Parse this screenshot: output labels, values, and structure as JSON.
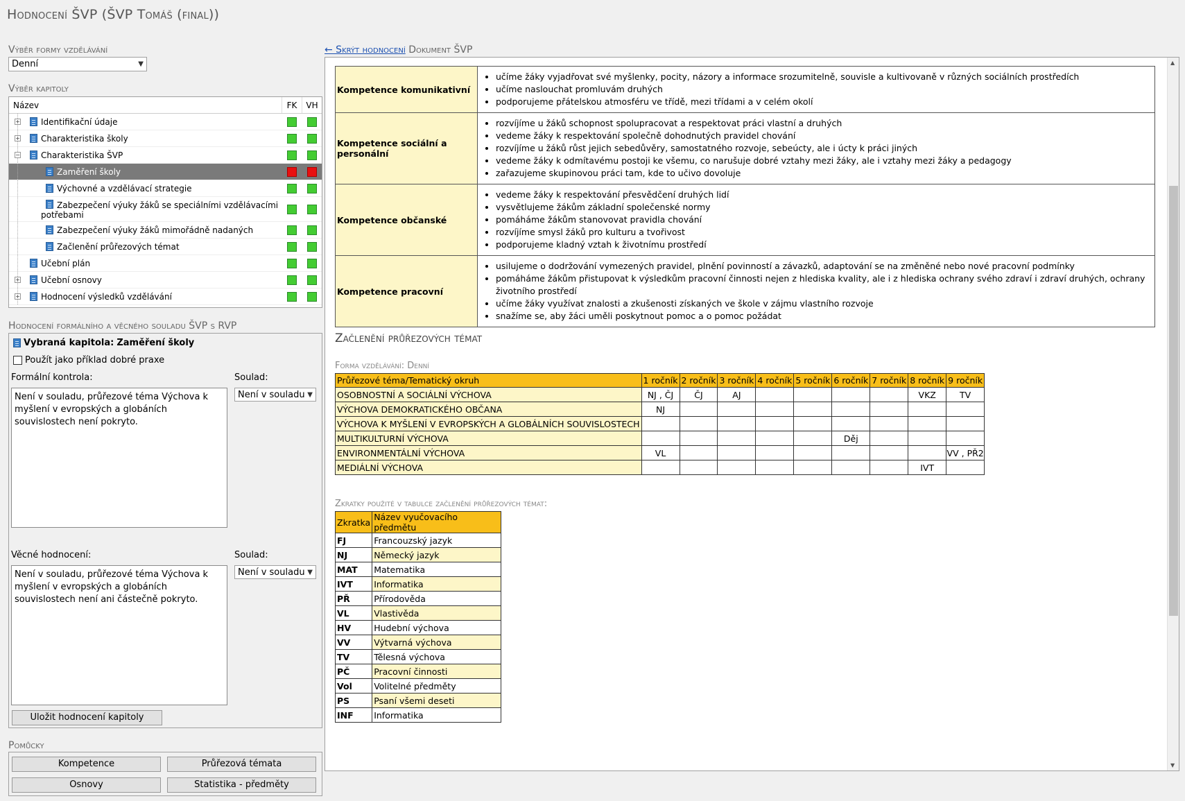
{
  "title": "Hodnocení ŠVP (ŠVP Tomáš (final))",
  "left": {
    "forma_label": "Výběr formy vzdělávání",
    "forma_value": "Denní",
    "kapitola_label": "Výběr kapitoly",
    "tree_headers": {
      "name": "Název",
      "fk": "FK",
      "vh": "VH"
    },
    "tree": [
      {
        "label": "Identifikační údaje",
        "level": 0,
        "expander": "+",
        "fk": "green",
        "vh": "green"
      },
      {
        "label": "Charakteristika školy",
        "level": 0,
        "expander": "+",
        "fk": "green",
        "vh": "green"
      },
      {
        "label": "Charakteristika ŠVP",
        "level": 0,
        "expander": "−",
        "fk": "green",
        "vh": "green"
      },
      {
        "label": "Zaměření školy",
        "level": 1,
        "expander": "",
        "fk": "red",
        "vh": "red",
        "selected": true
      },
      {
        "label": "Výchovné a vzdělávací strategie",
        "level": 1,
        "expander": "",
        "fk": "green",
        "vh": "green"
      },
      {
        "label": "Zabezpečení výuky žáků se speciálními vzdělávacími",
        "label2": "potřebami",
        "level": 1,
        "expander": "",
        "fk": "green",
        "vh": "green"
      },
      {
        "label": "Zabezpečení výuky žáků mimořádně nadaných",
        "level": 1,
        "expander": "",
        "fk": "green",
        "vh": "green"
      },
      {
        "label": "Začlenění průřezových témat",
        "level": 1,
        "expander": "",
        "fk": "green",
        "vh": "green"
      },
      {
        "label": "Učební plán",
        "level": 0,
        "expander": "",
        "fk": "green",
        "vh": "green"
      },
      {
        "label": "Učební osnovy",
        "level": 0,
        "expander": "+",
        "fk": "green",
        "vh": "green"
      },
      {
        "label": "Hodnocení výsledků vzdělávání",
        "level": 0,
        "expander": "+",
        "fk": "green",
        "vh": "green"
      }
    ],
    "hodnoceni_label": "Hodnocení formálního a věcného souladu ŠVP s RVP",
    "vybrana_prefix": "Vybraná kapitola:",
    "vybrana_value": "Zaměření školy",
    "priklad_label": "Použít jako příklad dobré praxe",
    "formalni_label": "Formální kontrola:",
    "soulad_label": "Soulad:",
    "formalni_soulad": "Není v souladu",
    "formalni_text": "Není v souladu, průřezové téma Výchova k myšlení v evropských a globáních souvislostech není pokryto.",
    "vecne_label": "Věcné hodnocení:",
    "vecne_soulad": "Není v souladu",
    "vecne_text": "Není v souladu, průřezové téma Výchova k myšlení v evropských a globáních souvislostech není ani částečně pokryto.",
    "ulozit": "Uložit hodnocení kapitoly",
    "pomucky_label": "Pomůcky",
    "pomucky": [
      "Kompetence",
      "Průřezová témata",
      "Osnovy",
      "Statistika - předměty"
    ]
  },
  "right": {
    "hide_link": "← Skrýt hodnocení",
    "doc_label": "Dokument ŠVP",
    "kompetence": [
      {
        "name": "Kompetence komunikativní",
        "items": [
          "učíme žáky vyjadřovat své myšlenky, pocity, názory a informace srozumitelně, souvisle a kultivovaně v různých sociálních prostředích",
          "učíme naslouchat promluvám druhých",
          "podporujeme přátelskou atmosféru ve třídě, mezi třídami a v celém okolí"
        ]
      },
      {
        "name": "Kompetence sociální a personální",
        "items": [
          "rozvíjíme u žáků schopnost spolupracovat a respektovat práci vlastní a druhých",
          "vedeme žáky k respektování společně dohodnutých pravidel chování",
          "rozvíjíme u žáků růst jejich sebedůvěry, samostatného rozvoje, sebeúcty, ale i úcty k práci jiných",
          "vedeme žáky k odmítavému postoji ke všemu, co narušuje dobré vztahy mezi žáky, ale i vztahy mezi žáky a pedagogy",
          "zařazujeme skupinovou práci tam, kde to učivo dovoluje"
        ]
      },
      {
        "name": "Kompetence občanské",
        "items": [
          "vedeme žáky k respektování přesvědčení druhých lidí",
          "vysvětlujeme žákům základní společenské normy",
          "pomáháme žákům stanovovat pravidla chování",
          "rozvíjíme smysl žáků pro kulturu a tvořivost",
          "podporujeme kladný vztah k životnímu prostředí"
        ]
      },
      {
        "name": "Kompetence pracovní",
        "items": [
          "usilujeme o dodržování vymezených pravidel, plnění povinností a závazků, adaptování se na změněné nebo nové pracovní podmínky",
          "pomáháme žákům přistupovat k výsledkům pracovní činnosti nejen z hlediska kvality, ale i z hlediska ochrany svého zdraví i zdraví druhých, ochrany životního prostředí",
          "učíme žáky využívat znalosti a zkušenosti získaných ve škole v zájmu vlastního rozvoje",
          "snažíme se, aby žáci uměli poskytnout pomoc a o pomoc požádat"
        ]
      }
    ],
    "zac_title": "Začlenění průřezových témat",
    "forma_label": "Forma vzdělávání: Denní",
    "zt_headers": [
      "Průřezové téma/Tematický okruh",
      "1 ročník",
      "2 ročník",
      "3 ročník",
      "4 ročník",
      "5 ročník",
      "6 ročník",
      "7 ročník",
      "8 ročník",
      "9 ročník"
    ],
    "zt_rows": [
      [
        "OSOBNOSTNÍ A SOCIÁLNÍ VÝCHOVA",
        "NJ , ČJ",
        "ČJ",
        "AJ",
        "",
        "",
        "",
        "",
        "VKZ",
        "TV"
      ],
      [
        "VÝCHOVA DEMOKRATICKÉHO OBČANA",
        "NJ",
        "",
        "",
        "",
        "",
        "",
        "",
        "",
        ""
      ],
      [
        "VÝCHOVA K MYŠLENÍ V EVROPSKÝCH A GLOBÁLNÍCH SOUVISLOSTECH",
        "",
        "",
        "",
        "",
        "",
        "",
        "",
        "",
        ""
      ],
      [
        "MULTIKULTURNÍ VÝCHOVA",
        "",
        "",
        "",
        "",
        "",
        "Děj",
        "",
        "",
        ""
      ],
      [
        "ENVIRONMENTÁLNÍ VÝCHOVA",
        "VL",
        "",
        "",
        "",
        "",
        "",
        "",
        "",
        "VV , PŘ2"
      ],
      [
        "MEDIÁLNÍ VÝCHOVA",
        "",
        "",
        "",
        "",
        "",
        "",
        "",
        "IVT",
        ""
      ]
    ],
    "zkr_label": "Zkratky použité v tabulce začlenění průřezových témat:",
    "abbr_headers": [
      "Zkratka",
      "Název vyučovacího předmětu"
    ],
    "abbr_rows": [
      [
        "FJ",
        "Francouzský jazyk"
      ],
      [
        "NJ",
        "Německý jazyk"
      ],
      [
        "MAT",
        "Matematika"
      ],
      [
        "IVT",
        "Informatika"
      ],
      [
        "PŘ",
        "Přírodověda"
      ],
      [
        "VL",
        "Vlastivěda"
      ],
      [
        "HV",
        "Hudební výchova"
      ],
      [
        "VV",
        "Výtvarná výchova"
      ],
      [
        "TV",
        "Tělesná výchova"
      ],
      [
        "PČ",
        "Pracovní činnosti"
      ],
      [
        "Vol",
        "Volitelné předměty"
      ],
      [
        "PS",
        "Psaní všemi deseti"
      ],
      [
        "INF",
        "Informatika"
      ]
    ]
  },
  "colors": {
    "header_orange": "#f8be19",
    "cell_yellow": "#fdf6c8",
    "status_green": "#44cc33",
    "status_red": "#e81010",
    "selected_row": "#7a7a7a"
  }
}
